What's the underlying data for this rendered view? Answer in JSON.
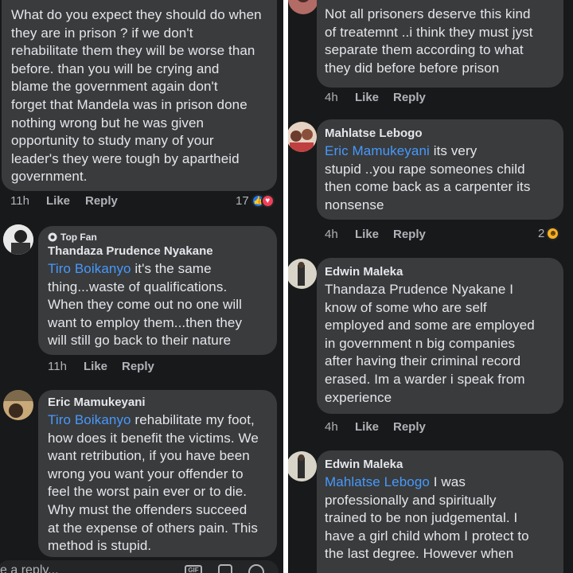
{
  "left": {
    "comment1": {
      "lines": [
        "What do you expect they should do when",
        "they are in prison  ? if we don't",
        "rehabilitate them they will be worse than",
        "before. than you will be crying and",
        "blame the government again  don't",
        "forget that Mandela was in prison done",
        "nothing wrong but he was given",
        "opportunity to study many of your",
        "leader's they were tough by apartheid",
        "government."
      ],
      "time": "11h",
      "like": "Like",
      "reply": "Reply",
      "reaction_count": "17"
    },
    "comment2": {
      "badge": "Top Fan",
      "author": "Thandaza Prudence Nyakane",
      "mention": "Tiro Boikanyo",
      "first_line_rest": " it's the same",
      "lines": [
        "thing...waste of qualifications.",
        "When they come out no one will",
        "want to employ them...then they",
        "will still go back to their nature"
      ],
      "time": "11h",
      "like": "Like",
      "reply": "Reply"
    },
    "comment3": {
      "author": "Eric Mamukeyani",
      "mention": "Tiro Boikanyo",
      "first_line_rest": " rehabilitate my foot,",
      "lines": [
        "how does it benefit the victims. We",
        "want retribution, if you have been",
        "wrong you want your offender to",
        "feel the worst pain ever or to die.",
        "Why must the offenders succeed",
        "at the expense of others pain. This",
        "method is stupid."
      ]
    },
    "reply_placeholder": "e a reply..."
  },
  "right": {
    "comment1": {
      "lines": [
        "Not all prisoners deserve this kind",
        "of treatemnt ..i think they must jyst",
        "separate them according to what",
        "they did before before prison"
      ],
      "time": "4h",
      "like": "Like",
      "reply": "Reply"
    },
    "comment2": {
      "author": "Mahlatse Lebogo",
      "mention": "Eric Mamukeyani",
      "first_line_rest": " its very",
      "lines": [
        "stupid ..you rape someones child",
        "then come back as a carpenter its",
        "nonsense"
      ],
      "time": "4h",
      "like": "Like",
      "reply": "Reply",
      "reaction_count": "2"
    },
    "comment3": {
      "author": "Edwin Maleka",
      "lines": [
        "Thandaza Prudence Nyakane I",
        "know of some who are self",
        "employed and some are employed",
        "in government n big companies",
        "after having  their criminal record",
        "erased. Im a warder i speak from",
        "experience"
      ],
      "time": "4h",
      "like": "Like",
      "reply": "Reply"
    },
    "comment4": {
      "author": "Edwin Maleka",
      "mention": "Mahlatse Lebogo",
      "first_line_rest": " I was",
      "lines": [
        "professionally  and spiritually",
        "trained to be non judgemental.  I",
        "have a girl child whom I protect to",
        "the last degree. However when"
      ]
    }
  },
  "colors": {
    "background": "#18191a",
    "bubble": "#3a3b3c",
    "text": "#e4e6eb",
    "meta": "#b0b3b8",
    "mention": "#4599ff",
    "like_reaction": "#1877f2",
    "love_reaction": "#f33e58",
    "haha_reaction": "#f7b125"
  }
}
